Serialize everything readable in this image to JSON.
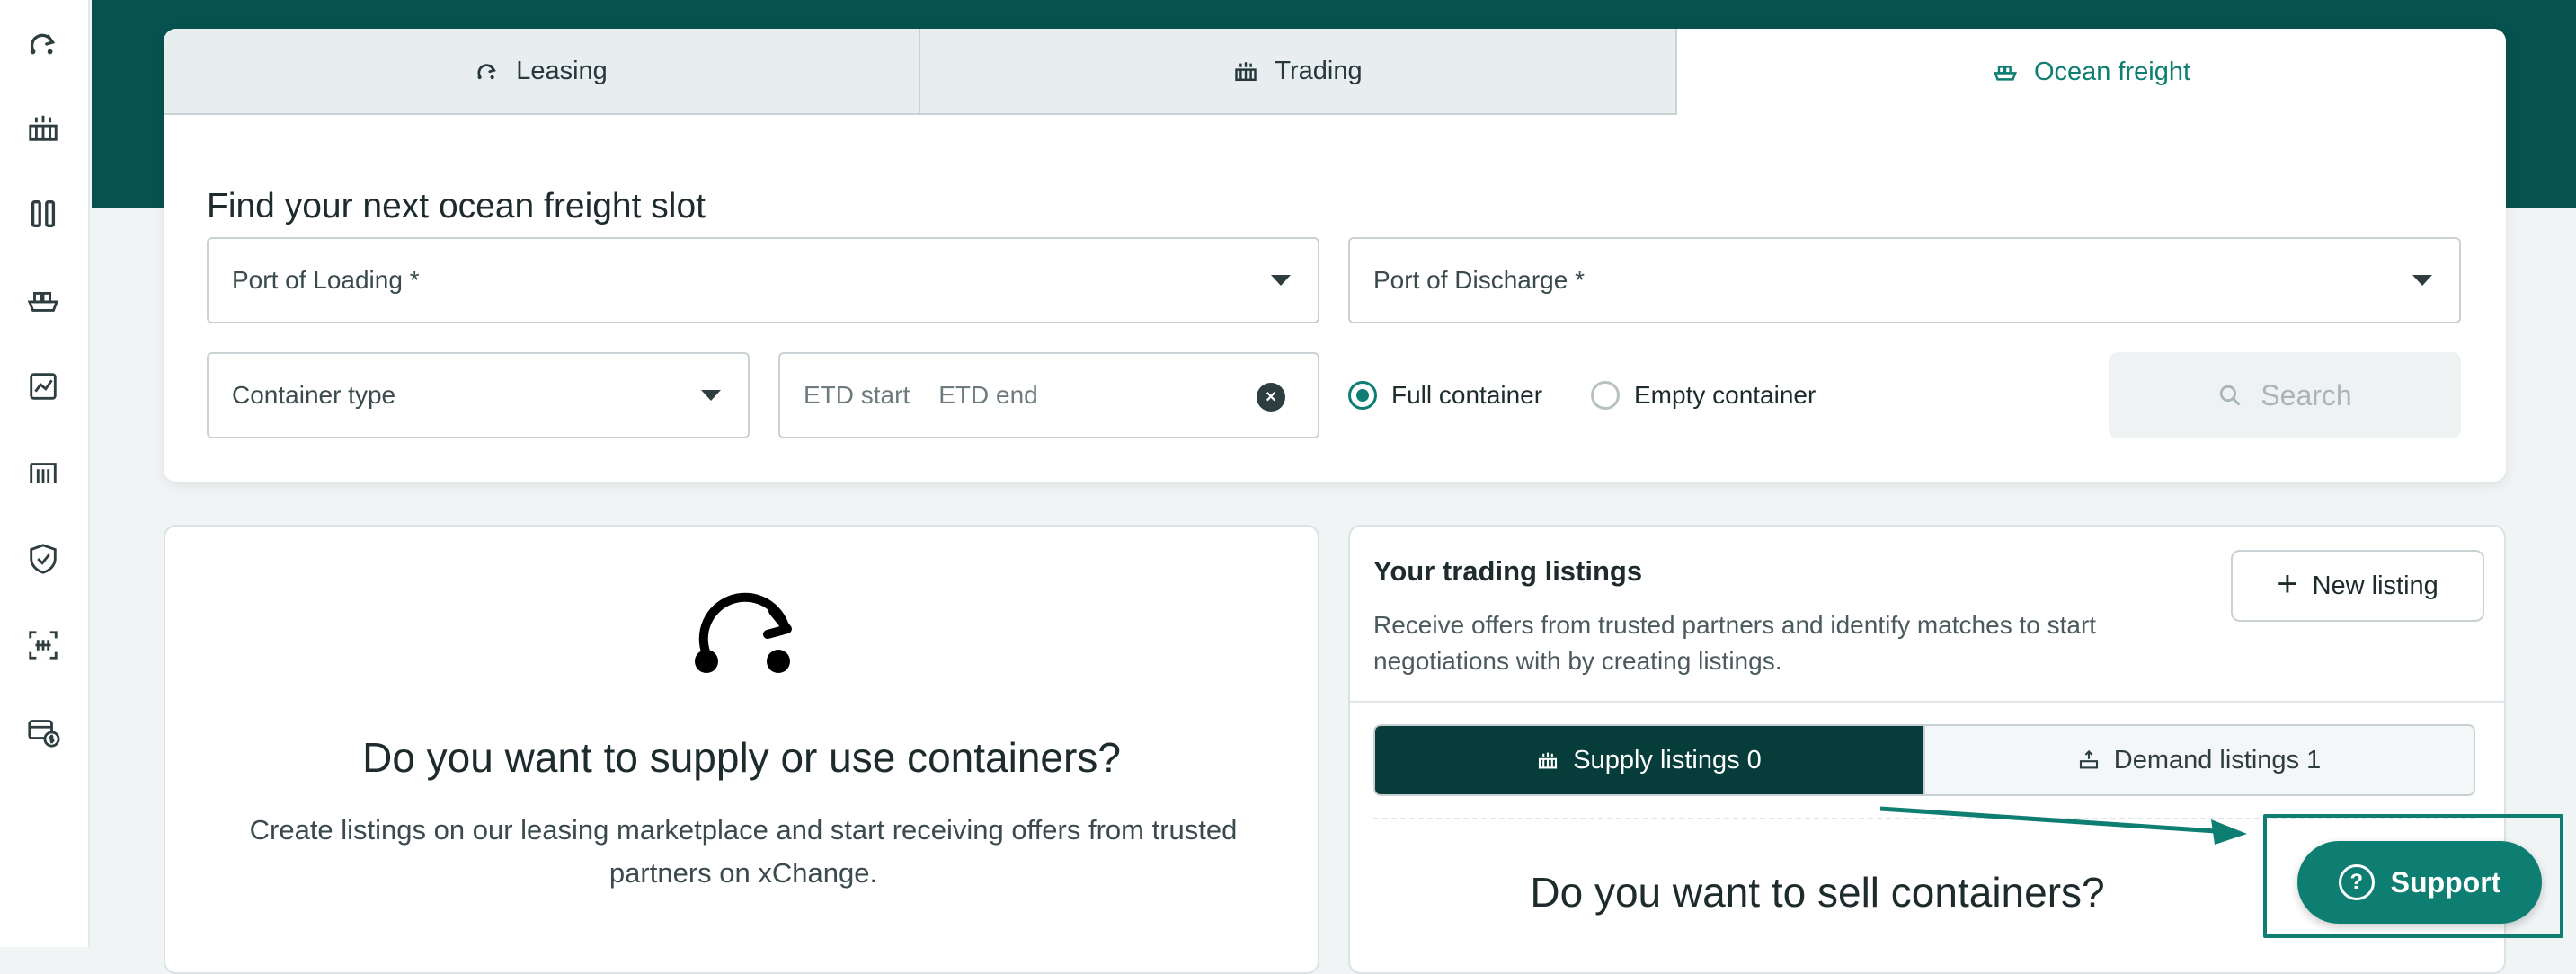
{
  "sidebar": {
    "icons": [
      {
        "name": "leasing-icon"
      },
      {
        "name": "trading-icon"
      },
      {
        "name": "columns-icon"
      },
      {
        "name": "ship-icon"
      },
      {
        "name": "analytics-icon"
      },
      {
        "name": "depot-icon"
      },
      {
        "name": "shield-check-icon"
      },
      {
        "name": "scan-icon"
      },
      {
        "name": "billing-icon"
      }
    ]
  },
  "tabs": [
    {
      "label": "Leasing",
      "icon": "leasing-icon"
    },
    {
      "label": "Trading",
      "icon": "trading-icon"
    },
    {
      "label": "Ocean freight",
      "icon": "ship-icon",
      "active": true
    }
  ],
  "search": {
    "title": "Find your next ocean freight slot",
    "port_of_loading": "Port of Loading *",
    "port_of_discharge": "Port of Discharge *",
    "container_type": "Container type",
    "etd_start": "ETD start",
    "etd_end": "ETD end",
    "radio_full": "Full container",
    "radio_empty": "Empty container",
    "selected_radio": "Full container",
    "search_button": "Search"
  },
  "leasing_panel": {
    "heading": "Do you want to supply or use containers?",
    "text": "Create listings on our leasing marketplace and start receiving offers from trusted partners on xChange."
  },
  "trading_panel": {
    "title": "Your trading listings",
    "description": "Receive offers from trusted partners and identify matches to start negotiations with by creating listings.",
    "new_listing": "New listing",
    "supply_tab": "Supply listings 0",
    "demand_tab": "Demand listings 1",
    "heading": "Do you want to sell containers?"
  },
  "support": {
    "label": "Support"
  },
  "colors": {
    "brand_dark": "#07524f",
    "accent": "#0e7e72",
    "segment_active": "#063c39"
  }
}
